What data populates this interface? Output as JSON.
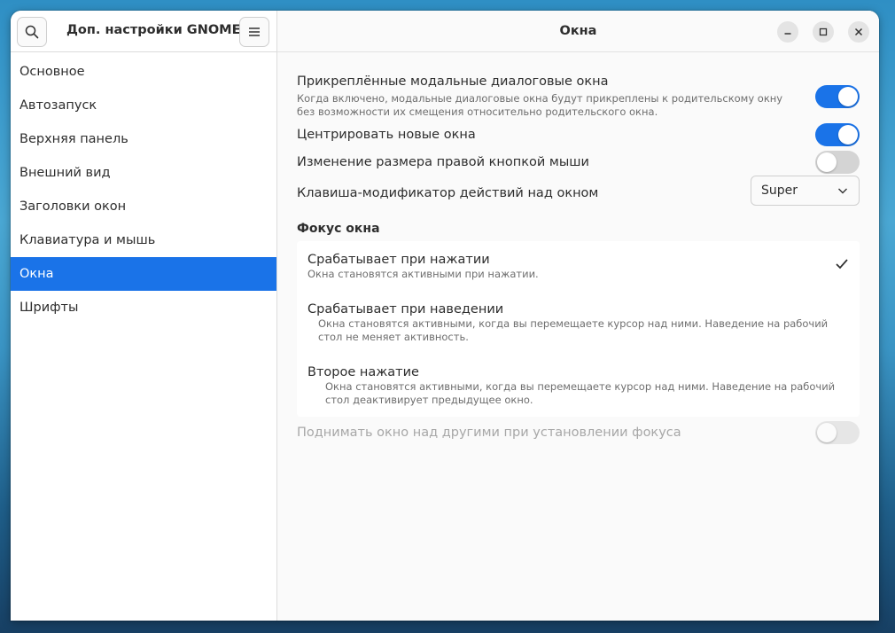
{
  "sidebar": {
    "title": "Доп. настройки GNOME",
    "search_icon": "search-icon",
    "menu_icon": "hamburger-menu-icon",
    "items": [
      {
        "label": "Основное",
        "active": false
      },
      {
        "label": "Автозапуск",
        "active": false
      },
      {
        "label": "Верхняя панель",
        "active": false
      },
      {
        "label": "Внешний вид",
        "active": false
      },
      {
        "label": "Заголовки окон",
        "active": false
      },
      {
        "label": "Клавиатура и мышь",
        "active": false
      },
      {
        "label": "Окна",
        "active": true
      },
      {
        "label": "Шрифты",
        "active": false
      }
    ]
  },
  "main": {
    "title": "Окна",
    "window_controls": [
      "minimize-icon",
      "maximize-icon",
      "close-icon"
    ],
    "settings": {
      "attach_modal": {
        "title": "Прикреплённые модальные диалоговые окна",
        "desc": "Когда включено, модальные диалоговые окна будут прикреплены к родительскому окну без возможности их смещения относительно родительского окна.",
        "enabled": true
      },
      "center_new": {
        "title": "Центрировать новые окна",
        "enabled": true
      },
      "resize_right": {
        "title": "Изменение размера правой кнопкой мыши",
        "enabled": false
      },
      "modifier_key": {
        "title": "Клавиша-модификатор действий над окном",
        "value": "Super"
      }
    },
    "focus": {
      "section_title": "Фокус окна",
      "options": [
        {
          "title": "Срабатывает при нажатии",
          "desc": "Окна становятся активными при нажатии.",
          "selected": true
        },
        {
          "title": "Срабатывает при наведении",
          "desc": "Окна становятся активными, когда вы перемещаете курсор над ними. Наведение на рабочий стол не меняет активность.",
          "selected": false
        },
        {
          "title": "Второе нажатие",
          "desc": "Окна становятся активными, когда вы перемещаете курсор над ними. Наведение на рабочий стол деактивирует предыдущее окно.",
          "selected": false
        }
      ]
    },
    "raise_on_focus": {
      "title": "Поднимать окно над другими при установлении фокуса",
      "enabled": false,
      "disabled": true
    }
  },
  "colors": {
    "accent": "#1a73e8",
    "background": "#fafafa",
    "text": "#2e2e2e"
  }
}
